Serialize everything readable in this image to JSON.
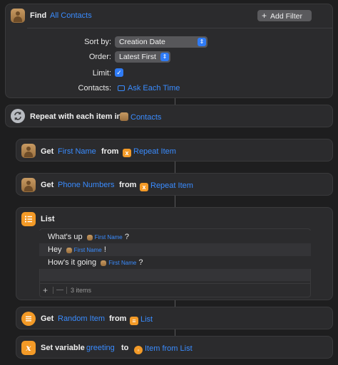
{
  "find": {
    "action_label": "Find",
    "source_label": "All Contacts",
    "add_filter_label": "Add Filter",
    "sort_by_label": "Sort by:",
    "sort_by_value": "Creation Date",
    "order_label": "Order:",
    "order_value": "Latest First",
    "limit_label": "Limit:",
    "limit_checked": true,
    "contacts_label": "Contacts:",
    "contacts_value": "Ask Each Time"
  },
  "repeat": {
    "label": "Repeat with each item in",
    "source": "Contacts"
  },
  "get_first_name": {
    "action": "Get",
    "property": "First Name",
    "from": "from",
    "source": "Repeat Item"
  },
  "get_phone": {
    "action": "Get",
    "property": "Phone Numbers",
    "from": "from",
    "source": "Repeat Item"
  },
  "list": {
    "title": "List",
    "items": [
      {
        "prefix": "What's up",
        "token": "First Name",
        "suffix": "?"
      },
      {
        "prefix": "Hey",
        "token": "First Name",
        "suffix": "!"
      },
      {
        "prefix": "How's it going",
        "token": "First Name",
        "suffix": "?"
      }
    ],
    "add_symbol": "+",
    "remove_symbol": "—",
    "count_label": "3 items"
  },
  "get_random": {
    "action": "Get",
    "property": "Random Item",
    "from": "from",
    "source": "List"
  },
  "set_variable": {
    "action": "Set variable",
    "name": "greeting",
    "to": "to",
    "source": "Item from List"
  },
  "colors": {
    "background": "#1e1e1f",
    "card": "#2b2b2d",
    "accent": "#3a8cff",
    "orange": "#f39a27"
  }
}
